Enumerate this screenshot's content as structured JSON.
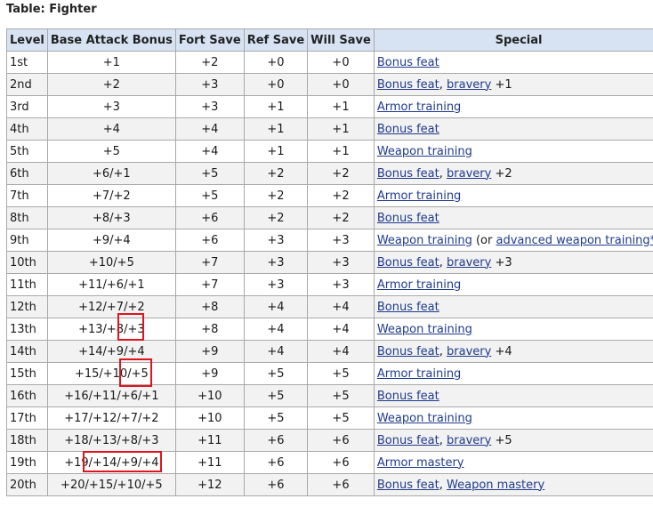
{
  "caption": "Table: Fighter",
  "headers": {
    "level": "Level",
    "bab": "Base Attack Bonus",
    "fort": "Fort Save",
    "ref": "Ref Save",
    "will": "Will Save",
    "special": "Special"
  },
  "rows": [
    {
      "level": "1st",
      "bab": "+1",
      "fort": "+2",
      "ref": "+0",
      "will": "+0",
      "special": [
        {
          "t": "Bonus feat",
          "link": true
        }
      ]
    },
    {
      "level": "2nd",
      "bab": "+2",
      "fort": "+3",
      "ref": "+0",
      "will": "+0",
      "special": [
        {
          "t": "Bonus feat",
          "link": true
        },
        {
          "t": ", ",
          "link": false
        },
        {
          "t": "bravery",
          "link": true
        },
        {
          "t": " +1",
          "link": false
        }
      ]
    },
    {
      "level": "3rd",
      "bab": "+3",
      "fort": "+3",
      "ref": "+1",
      "will": "+1",
      "special": [
        {
          "t": "Armor training",
          "link": true
        }
      ]
    },
    {
      "level": "4th",
      "bab": "+4",
      "fort": "+4",
      "ref": "+1",
      "will": "+1",
      "special": [
        {
          "t": "Bonus feat",
          "link": true
        }
      ]
    },
    {
      "level": "5th",
      "bab": "+5",
      "fort": "+4",
      "ref": "+1",
      "will": "+1",
      "special": [
        {
          "t": "Weapon training",
          "link": true
        }
      ]
    },
    {
      "level": "6th",
      "bab": "+6/+1",
      "fort": "+5",
      "ref": "+2",
      "will": "+2",
      "special": [
        {
          "t": "Bonus feat",
          "link": true
        },
        {
          "t": ", ",
          "link": false
        },
        {
          "t": "bravery",
          "link": true
        },
        {
          "t": " +2",
          "link": false
        }
      ]
    },
    {
      "level": "7th",
      "bab": "+7/+2",
      "fort": "+5",
      "ref": "+2",
      "will": "+2",
      "special": [
        {
          "t": "Armor training",
          "link": true
        }
      ]
    },
    {
      "level": "8th",
      "bab": "+8/+3",
      "fort": "+6",
      "ref": "+2",
      "will": "+2",
      "special": [
        {
          "t": "Bonus feat",
          "link": true
        }
      ]
    },
    {
      "level": "9th",
      "bab": "+9/+4",
      "fort": "+6",
      "ref": "+3",
      "will": "+3",
      "special": [
        {
          "t": "Weapon training",
          "link": true
        },
        {
          "t": " (or ",
          "link": false
        },
        {
          "t": "advanced weapon training",
          "link": true
        },
        {
          "t": "*",
          "link": true
        },
        {
          "t": ")",
          "link": false
        }
      ]
    },
    {
      "level": "10th",
      "bab": "+10/+5",
      "fort": "+7",
      "ref": "+3",
      "will": "+3",
      "special": [
        {
          "t": "Bonus feat",
          "link": true
        },
        {
          "t": ", ",
          "link": false
        },
        {
          "t": "bravery",
          "link": true
        },
        {
          "t": " +3",
          "link": false
        }
      ]
    },
    {
      "level": "11th",
      "bab": "+11/+6/+1",
      "fort": "+7",
      "ref": "+3",
      "will": "+3",
      "special": [
        {
          "t": "Armor training",
          "link": true
        }
      ]
    },
    {
      "level": "12th",
      "bab": "+12/+7/+2",
      "fort": "+8",
      "ref": "+4",
      "will": "+4",
      "special": [
        {
          "t": "Bonus feat",
          "link": true
        }
      ]
    },
    {
      "level": "13th",
      "bab": "+13/+8/+3",
      "fort": "+8",
      "ref": "+4",
      "will": "+4",
      "special": [
        {
          "t": "Weapon training",
          "link": true
        }
      ]
    },
    {
      "level": "14th",
      "bab": "+14/+9/+4",
      "fort": "+9",
      "ref": "+4",
      "will": "+4",
      "special": [
        {
          "t": "Bonus feat",
          "link": true
        },
        {
          "t": ", ",
          "link": false
        },
        {
          "t": "bravery",
          "link": true
        },
        {
          "t": " +4",
          "link": false
        }
      ]
    },
    {
      "level": "15th",
      "bab": "+15/+10/+5",
      "fort": "+9",
      "ref": "+5",
      "will": "+5",
      "special": [
        {
          "t": "Armor training",
          "link": true
        }
      ]
    },
    {
      "level": "16th",
      "bab": "+16/+11/+6/+1",
      "fort": "+10",
      "ref": "+5",
      "will": "+5",
      "special": [
        {
          "t": "Bonus feat",
          "link": true
        }
      ]
    },
    {
      "level": "17th",
      "bab": "+17/+12/+7/+2",
      "fort": "+10",
      "ref": "+5",
      "will": "+5",
      "special": [
        {
          "t": "Weapon training",
          "link": true
        }
      ]
    },
    {
      "level": "18th",
      "bab": "+18/+13/+8/+3",
      "fort": "+11",
      "ref": "+6",
      "will": "+6",
      "special": [
        {
          "t": "Bonus feat",
          "link": true
        },
        {
          "t": ", ",
          "link": false
        },
        {
          "t": "bravery",
          "link": true
        },
        {
          "t": " +5",
          "link": false
        }
      ]
    },
    {
      "level": "19th",
      "bab": "+19/+14/+9/+4",
      "fort": "+11",
      "ref": "+6",
      "will": "+6",
      "special": [
        {
          "t": "Armor mastery",
          "link": true
        }
      ]
    },
    {
      "level": "20th",
      "bab": "+20/+15/+10/+5",
      "fort": "+12",
      "ref": "+6",
      "will": "+6",
      "special": [
        {
          "t": "Bonus feat",
          "link": true
        },
        {
          "t": ", ",
          "link": false
        },
        {
          "t": "Weapon mastery",
          "link": true
        }
      ]
    }
  ],
  "colors": {
    "header_bg": "#d7e3f3",
    "link": "#1f3b8c",
    "highlight": "#e0141e",
    "border": "#a9a9a9"
  }
}
